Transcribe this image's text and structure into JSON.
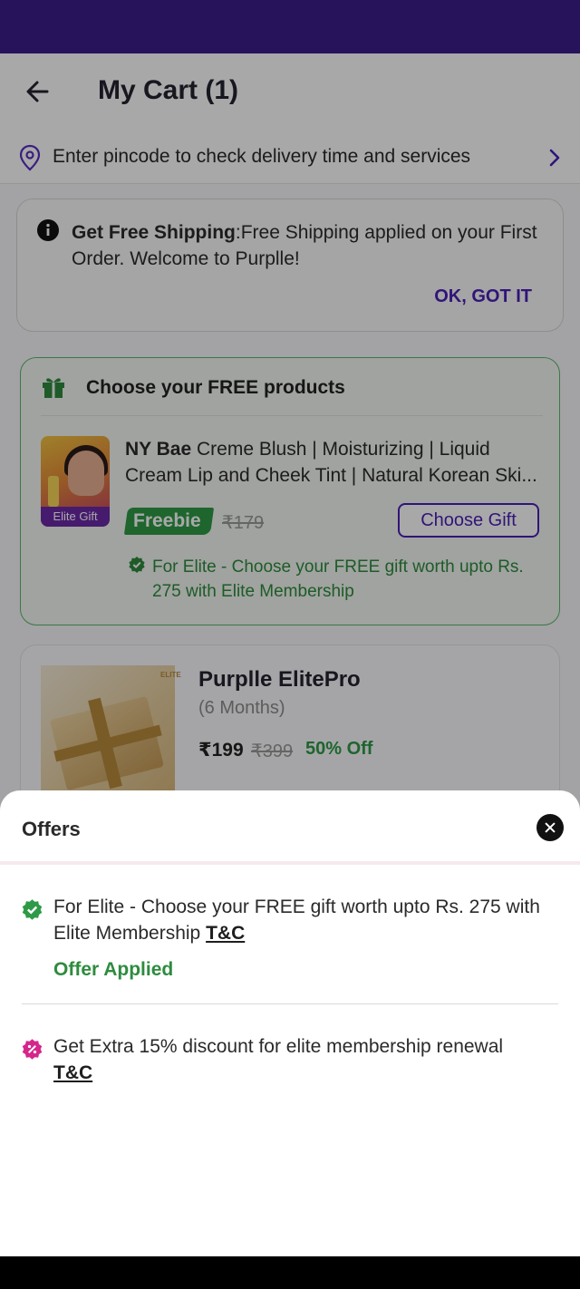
{
  "header": {
    "title": "My Cart (1)"
  },
  "pincode": {
    "text": "Enter pincode to check delivery time and services"
  },
  "shipping_info": {
    "bold": "Get Free Shipping",
    "text": ":Free Shipping applied on your First Order. Welcome to Purplle!",
    "action": "OK, GOT IT"
  },
  "free_products": {
    "title": "Choose your FREE products",
    "product": {
      "brand": "NY Bae",
      "name_line1": "Creme Blush | Moisturizing | Liquid",
      "name_line2": "Cream Lip and Cheek Tint | Natural Korean Ski...",
      "badge": "Elite Gift",
      "freebie_label": "Freebie",
      "mrp": "₹179",
      "button": "Choose Gift"
    },
    "note": "For Elite - Choose your FREE gift worth upto Rs. 275 with Elite Membership"
  },
  "elite_pro": {
    "name": "Purplle ElitePro",
    "duration": "(6 Months)",
    "price": "₹199",
    "mrp": "₹399",
    "discount": "50% Off",
    "badge": "ELITE"
  },
  "offers_sheet": {
    "title": "Offers",
    "offers": [
      {
        "text": "For Elite - Choose your FREE gift worth upto Rs. 275 with Elite Membership",
        "tc": "T&C",
        "status": "Offer Applied"
      },
      {
        "text": "Get Extra 15% discount for elite membership renewal",
        "tc": "T&C"
      }
    ]
  },
  "colors": {
    "brand_purple": "#4a1fb8",
    "status_bar": "#3a1e8a",
    "success_green": "#2e8b3e",
    "offer_pink": "#d6268c"
  }
}
